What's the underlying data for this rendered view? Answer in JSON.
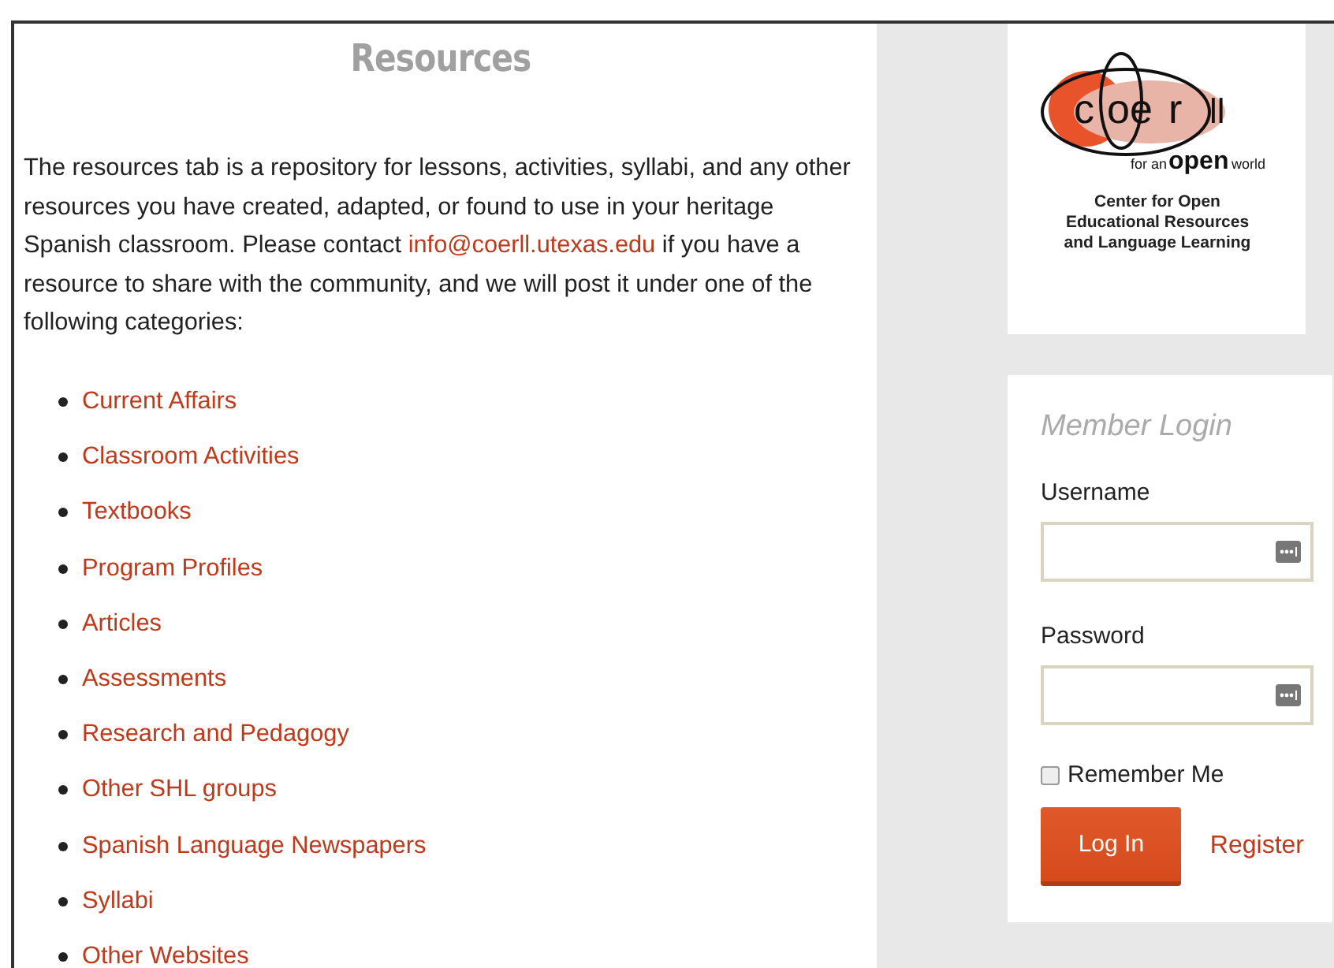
{
  "main": {
    "title": "Resources",
    "intro": {
      "before": "The resources tab is a repository for lessons, activities, syllabi, and any other resources you have created, adapted, or found to use in your heritage Spanish classroom. Please contact",
      "link": "info@coerll.utexas.edu",
      "after": "if you have a resource to share with the community, and we will post it under one of the following categories:"
    },
    "categories": [
      "Current Affairs",
      "Classroom Activities",
      "Textbooks",
      "Program Profiles",
      "Articles",
      "Assessments",
      "Research and Pedagogy",
      "Other SHL groups",
      "Spanish Language Newspapers",
      "Syllabi",
      "Other Websites"
    ]
  },
  "logo": {
    "wordmark_left": "c",
    "wordmark_mid": "oe",
    "wordmark_r": "r",
    "wordmark_right": "ll",
    "tagline_pre": "for an",
    "tagline_open": "open",
    "tagline_post": "world",
    "caption": [
      "Center for Open",
      "Educational Resources",
      "and Language Learning"
    ]
  },
  "login": {
    "title": "Member Login",
    "fields": [
      {
        "label": "Username"
      },
      {
        "label": "Password"
      }
    ],
    "remember": {
      "label": "Remember Me",
      "checked": false
    },
    "submit": "Log In",
    "register": "Register"
  }
}
